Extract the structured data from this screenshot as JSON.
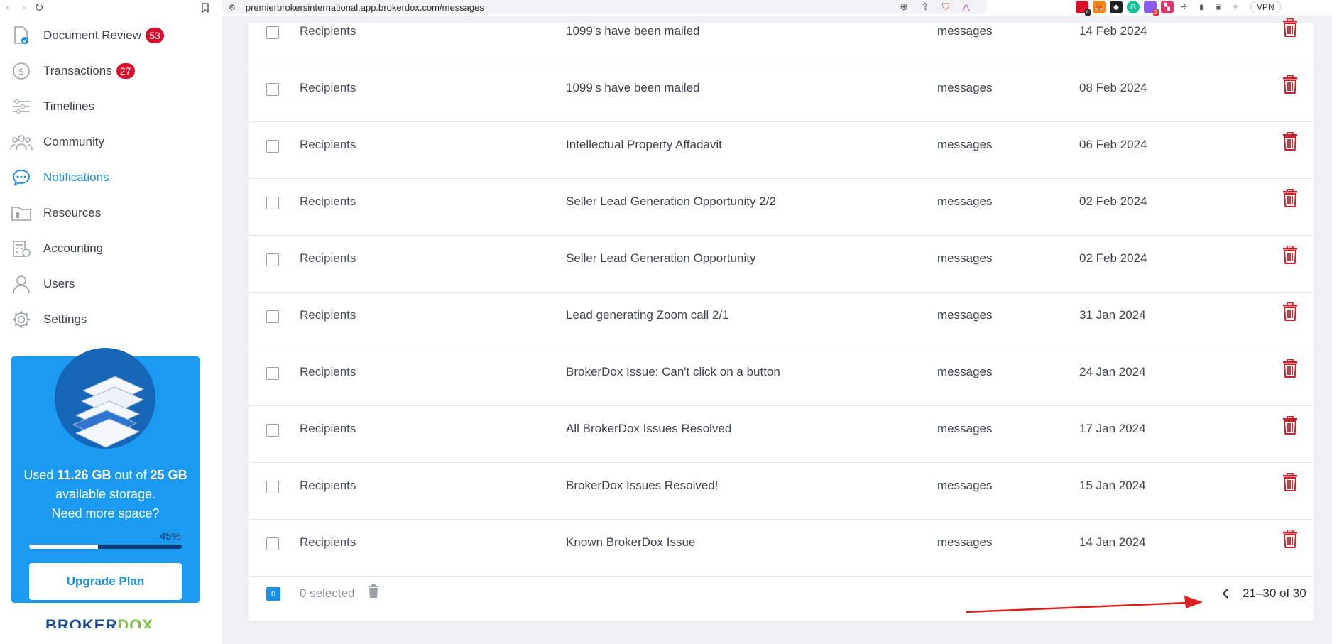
{
  "browser": {
    "url": "premierbrokersinternational.app.brokerdox.com/messages",
    "ext_badges": [
      "4",
      "2"
    ],
    "vpn_label": "VPN"
  },
  "sidebar": {
    "items": [
      {
        "label": "Document Review",
        "badge": "53",
        "icon": "document-check-icon"
      },
      {
        "label": "Transactions",
        "badge": "27",
        "icon": "dollar-icon"
      },
      {
        "label": "Timelines",
        "icon": "timeline-icon"
      },
      {
        "label": "Community",
        "icon": "community-icon"
      },
      {
        "label": "Notifications",
        "icon": "chat-bubble-icon",
        "active": true
      },
      {
        "label": "Resources",
        "icon": "folder-icon"
      },
      {
        "label": "Accounting",
        "icon": "calculator-icon"
      },
      {
        "label": "Users",
        "icon": "user-icon"
      },
      {
        "label": "Settings",
        "icon": "gear-icon"
      }
    ],
    "storage": {
      "used_prefix": "Used ",
      "used_value": "11.26 GB",
      "out_of": " out of ",
      "total_value": "25 GB",
      "suffix": " available storage.",
      "cta": "Need more space?",
      "percent_label": "45%",
      "percent": 45,
      "upgrade_label": "Upgrade Plan"
    },
    "logo": {
      "part1": "BROKER",
      "part2": "DOX"
    }
  },
  "messages": {
    "rows": [
      {
        "to": "Recipients",
        "subject": "1099's have been mailed",
        "type": "messages",
        "date": "14 Feb 2024"
      },
      {
        "to": "Recipients",
        "subject": "1099's have been mailed",
        "type": "messages",
        "date": "08 Feb 2024"
      },
      {
        "to": "Recipients",
        "subject": "Intellectual Property Affadavit",
        "type": "messages",
        "date": "06 Feb 2024"
      },
      {
        "to": "Recipients",
        "subject": "Seller Lead Generation Opportunity 2/2",
        "type": "messages",
        "date": "02 Feb 2024"
      },
      {
        "to": "Recipients",
        "subject": "Seller Lead Generation Opportunity",
        "type": "messages",
        "date": "02 Feb 2024"
      },
      {
        "to": "Recipients",
        "subject": "Lead generating Zoom call 2/1",
        "type": "messages",
        "date": "31 Jan 2024"
      },
      {
        "to": "Recipients",
        "subject": "BrokerDox Issue: Can't click on a button",
        "type": "messages",
        "date": "24 Jan 2024"
      },
      {
        "to": "Recipients",
        "subject": "All BrokerDox Issues Resolved",
        "type": "messages",
        "date": "17 Jan 2024"
      },
      {
        "to": "Recipients",
        "subject": "BrokerDox Issues Resolved!",
        "type": "messages",
        "date": "15 Jan 2024"
      },
      {
        "to": "Recipients",
        "subject": "Known BrokerDox Issue",
        "type": "messages",
        "date": "14 Jan 2024"
      }
    ],
    "footer": {
      "selected_count": "0",
      "selected_label": "0 selected",
      "pagination": "21–30 of 30"
    }
  },
  "colors": {
    "accent": "#1a8fe3",
    "badge": "#d8102c",
    "delete": "#d0202a",
    "annotation_arrow": "#e02020"
  }
}
